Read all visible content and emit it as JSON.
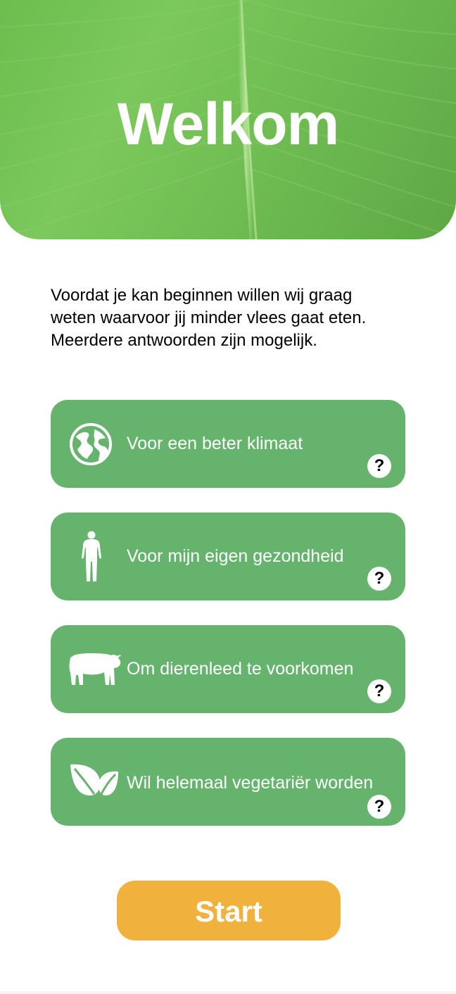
{
  "hero": {
    "title": "Welkom"
  },
  "intro": {
    "line1": "Voordat je kan beginnen willen wij graag",
    "line2": "weten waarvoor jij minder vlees gaat eten.",
    "line3": "Meerdere antwoorden zijn mogelijk."
  },
  "options": [
    {
      "label": "Voor een beter klimaat",
      "icon": "globe-icon",
      "help": "?"
    },
    {
      "label": "Voor mijn eigen gezondheid",
      "icon": "human-body-icon",
      "help": "?"
    },
    {
      "label": "Om dierenleed te voorkomen",
      "icon": "cow-icon",
      "help": "?"
    },
    {
      "label": "Wil helemaal vegetariër worden",
      "icon": "leaves-icon",
      "help": "?"
    }
  ],
  "start": {
    "label": "Start"
  },
  "colors": {
    "hero_green": "#72c155",
    "option_green": "#66b36d",
    "start_orange": "#f0b23c",
    "text": "#000000",
    "white": "#ffffff"
  }
}
